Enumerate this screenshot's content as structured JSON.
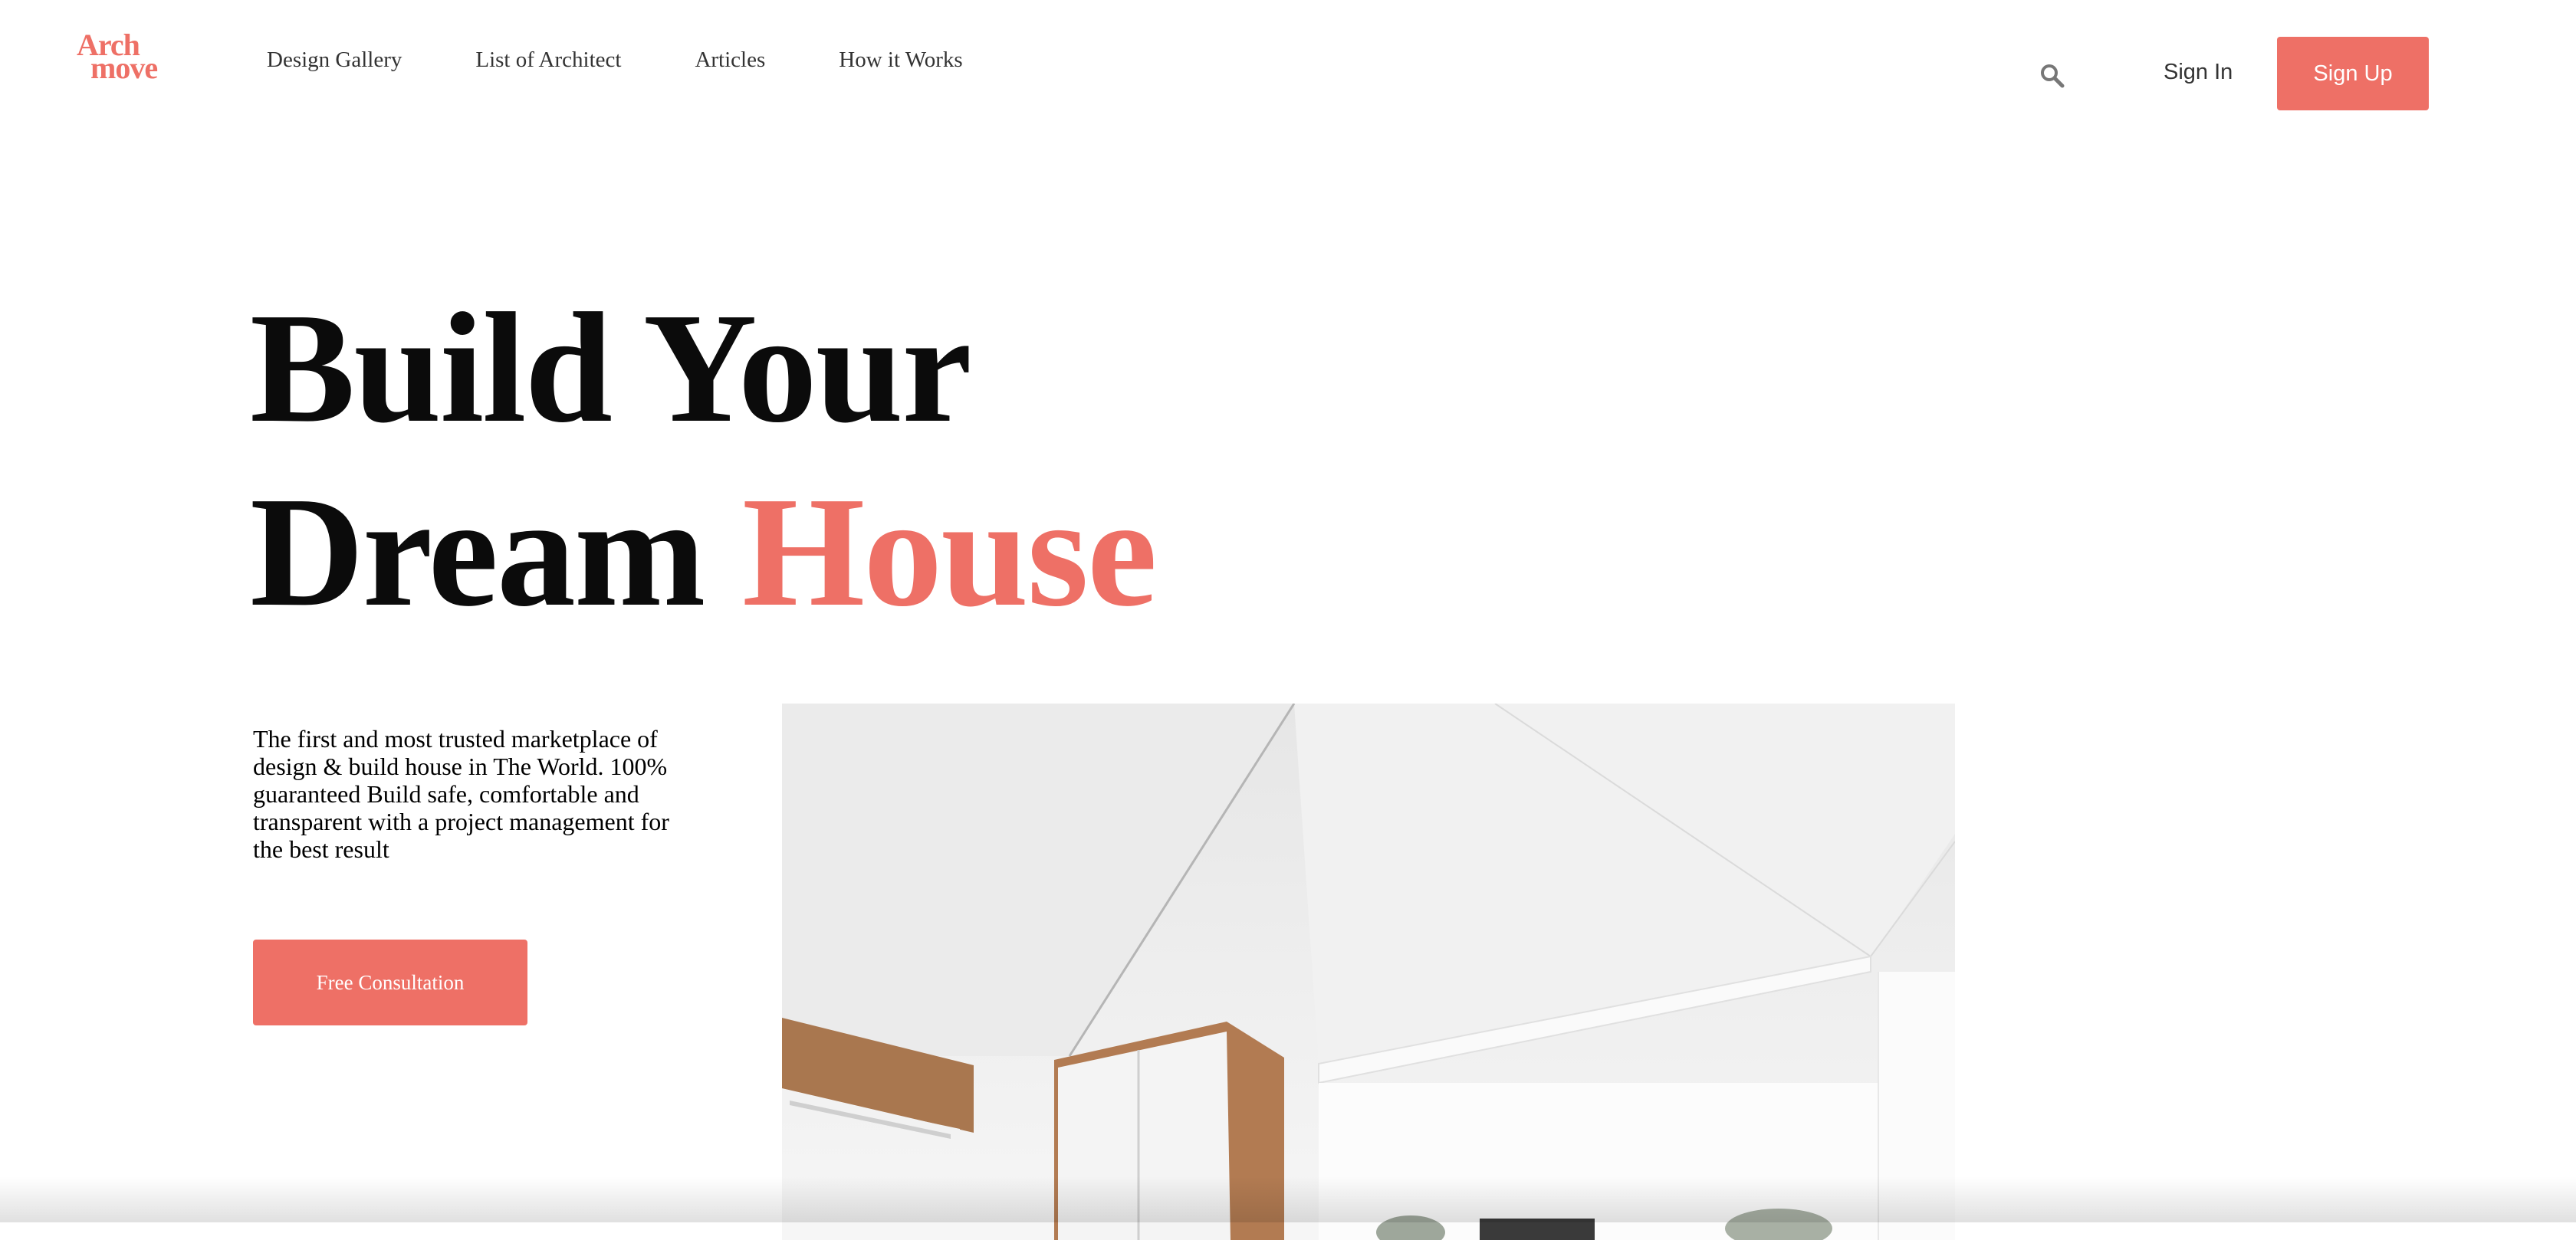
{
  "brand": {
    "line1": "Arch",
    "line2": "move",
    "color": "#ee7066"
  },
  "nav": {
    "items": [
      {
        "label": "Design Gallery"
      },
      {
        "label": "List of Architect"
      },
      {
        "label": "Articles"
      },
      {
        "label": "How it Works"
      }
    ]
  },
  "header": {
    "search_icon": "search-icon",
    "sign_in_label": "Sign In",
    "sign_up_label": "Sign Up"
  },
  "hero": {
    "title_part1": "Build Your",
    "title_part2": "Dream",
    "title_accent": "House",
    "description": "The first and most trusted marketplace of design & build house in The World. 100% guaranteed Build safe, comfortable and transparent with a project management for the best result",
    "cta_label": "Free Consultation"
  },
  "colors": {
    "accent": "#ee7066",
    "text": "#0b0b0b",
    "nav_text": "#333333"
  }
}
